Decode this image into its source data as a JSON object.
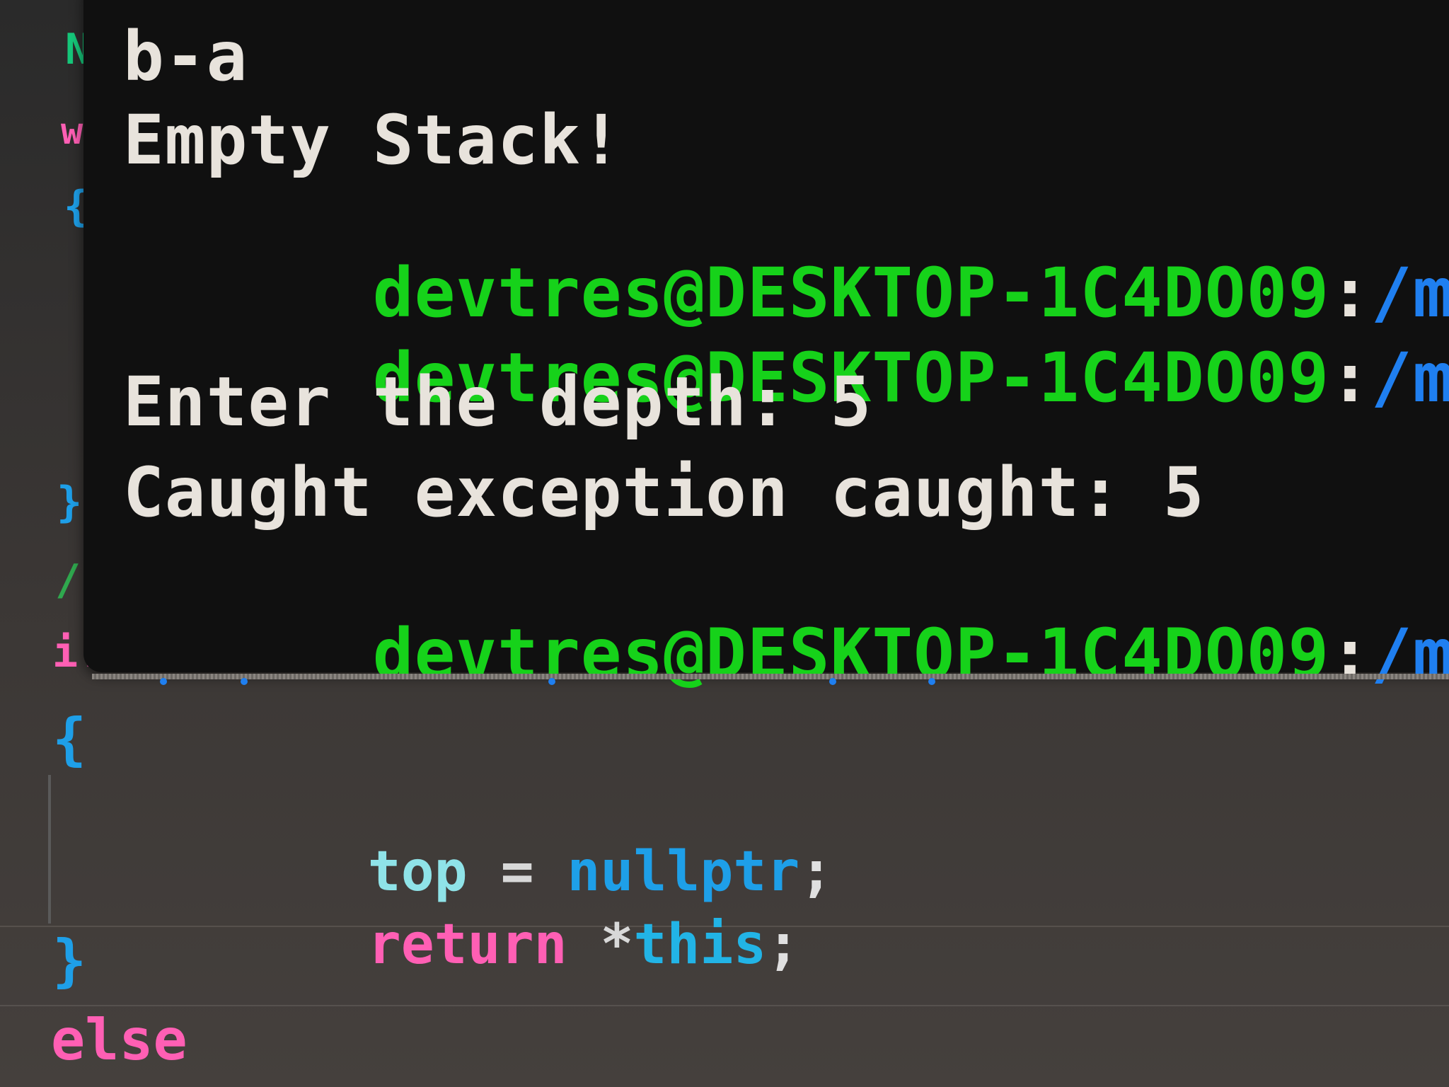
{
  "editor": {
    "gutter": {
      "n": "N",
      "w": "w",
      "brace_open_1": "{",
      "brace_close_1": "}",
      "slash": "/",
      "i": "i.",
      "brace_open_2": "{",
      "brace_close_2": "}"
    },
    "code": {
      "line1": {
        "var": "top",
        "op": " = ",
        "kw": "nullptr",
        "punct": ";"
      },
      "line2": {
        "kw": "return",
        "space": " ",
        "star": "*",
        "this": "this",
        "punct": ";"
      },
      "else": "else"
    }
  },
  "terminal": {
    "lines": [
      {
        "type": "output",
        "text": "b-a"
      },
      {
        "type": "output",
        "text": "Empty Stack!"
      },
      {
        "type": "prompt",
        "user": "devtres@DESKTOP-1C4DO09",
        "sep": ":",
        "path": "/mnt/c/"
      },
      {
        "type": "prompt",
        "user": "devtres@DESKTOP-1C4DO09",
        "sep": ":",
        "path": "/mnt/c/"
      },
      {
        "type": "output",
        "text": "Enter the depth: 5"
      },
      {
        "type": "output",
        "text": "Caught exception caught: 5"
      },
      {
        "type": "prompt",
        "user": "devtres@DESKTOP-1C4DO09",
        "sep": ":",
        "path": "/mnt/c/"
      }
    ]
  },
  "colors": {
    "prompt_user": "#16d21a",
    "prompt_path": "#1f7ff0",
    "output": "#e8e3dc",
    "keyword_pink": "#ff5fb4",
    "keyword_blue": "#1e9fe8"
  }
}
